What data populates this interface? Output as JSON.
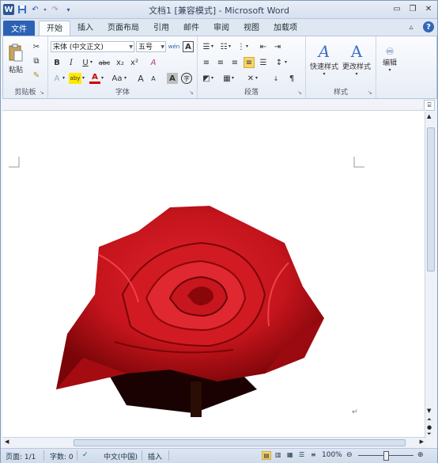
{
  "window": {
    "title": "文档1 [兼容模式] - Microsoft Word",
    "app_logo": "W"
  },
  "qat": {
    "icons": [
      "word-logo",
      "save-icon",
      "undo-icon",
      "redo-icon",
      "customize-qat-icon"
    ]
  },
  "tabs": {
    "file": "文件",
    "items": [
      "开始",
      "插入",
      "页面布局",
      "引用",
      "邮件",
      "审阅",
      "视图",
      "加载项"
    ],
    "active": "开始"
  },
  "ribbon": {
    "clipboard": {
      "label": "剪贴板",
      "paste": "粘贴"
    },
    "font": {
      "label": "字体",
      "font_name": "宋体 (中文正文)",
      "font_size": "五号",
      "phonetic": "wén",
      "border_char": "A",
      "bold": "B",
      "italic": "I",
      "underline": "U",
      "strike": "abc",
      "subscript": "x₂",
      "superscript": "x²",
      "clear_format": "A",
      "highlight": "aby",
      "font_color": "A",
      "case": "Aa",
      "grow": "A",
      "shrink": "A",
      "shading": "A",
      "enclose": "字"
    },
    "paragraph": {
      "label": "段落"
    },
    "styles": {
      "label": "样式",
      "quick": "快速样式",
      "change": "更改样式"
    },
    "editing": {
      "label": "编辑"
    }
  },
  "document": {
    "paragraph_mark": "↵"
  },
  "status": {
    "page": "页面: 1/1",
    "words": "字数: 0",
    "language": "中文(中国)",
    "mode": "插入",
    "zoom": "100%"
  },
  "colors": {
    "accent": "#2b62b5",
    "rose": "#c4141c"
  }
}
